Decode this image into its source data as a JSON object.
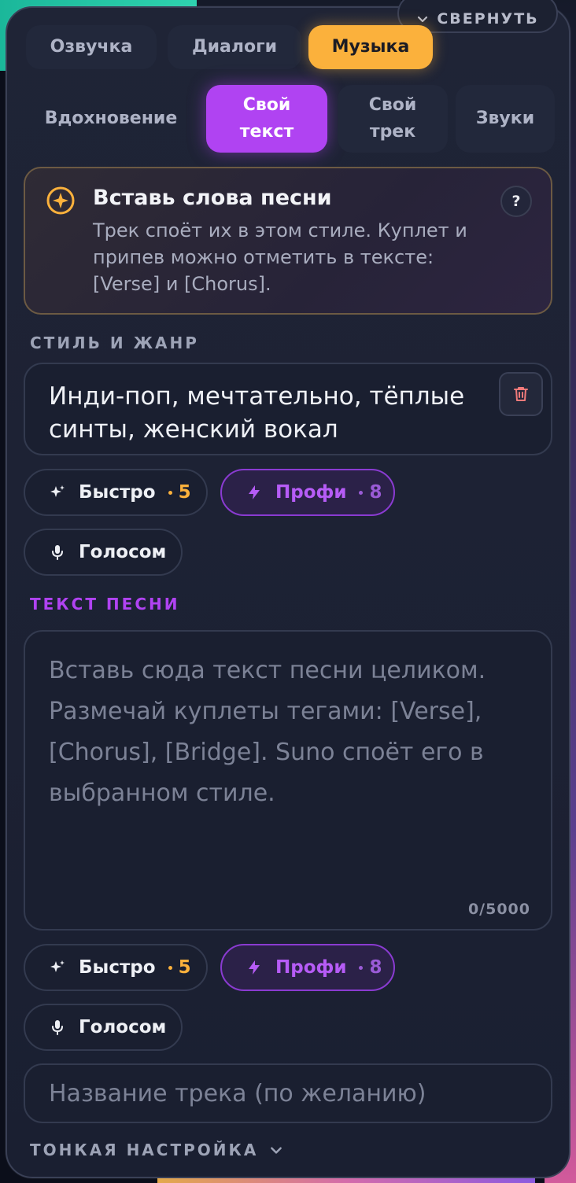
{
  "header": {
    "collapse_label": "СВЕРНУТЬ"
  },
  "main_tabs": [
    {
      "label": "Озвучка",
      "active": false
    },
    {
      "label": "Диалоги",
      "active": false
    },
    {
      "label": "Музыка",
      "active": true
    }
  ],
  "sub_tabs": [
    {
      "label": "Вдохновение",
      "active": false
    },
    {
      "label": "Свой текст",
      "active": true
    },
    {
      "label": "Свой трек",
      "active": false
    },
    {
      "label": "Звуки",
      "active": false
    }
  ],
  "info": {
    "title": "Вставь слова песни",
    "text": "Трек споёт их в этом стиле. Куплет и припев можно отметить в тексте: [Verse] и [Chorus].",
    "help_label": "?"
  },
  "style": {
    "section_label": "СТИЛЬ И ЖАНР",
    "value": "Инди-поп, мечтательно, тёплые синты, женский вокал"
  },
  "style_actions": {
    "fast": {
      "label": "Быстро",
      "cost": "5"
    },
    "pro": {
      "label": "Профи",
      "cost": "8"
    },
    "voice": {
      "label": "Голосом"
    }
  },
  "lyrics": {
    "section_label": "ТЕКСТ ПЕСНИ",
    "placeholder": "Вставь сюда текст песни целиком. Размечай куплеты тегами: [Verse], [Chorus], [Bridge]. Suno споёт его в выбранном стиле.",
    "counter": "0/5000"
  },
  "lyrics_actions": {
    "fast": {
      "label": "Быстро",
      "cost": "5"
    },
    "pro": {
      "label": "Профи",
      "cost": "8"
    },
    "voice": {
      "label": "Голосом"
    }
  },
  "track_title": {
    "placeholder": "Название трека (по желанию)"
  },
  "fine_tune": {
    "label": "ТОНКАЯ НАСТРОЙКА"
  },
  "colors": {
    "accent_orange": "#fbb13c",
    "accent_purple": "#b043f2",
    "panel_bg": "#1f2436"
  }
}
